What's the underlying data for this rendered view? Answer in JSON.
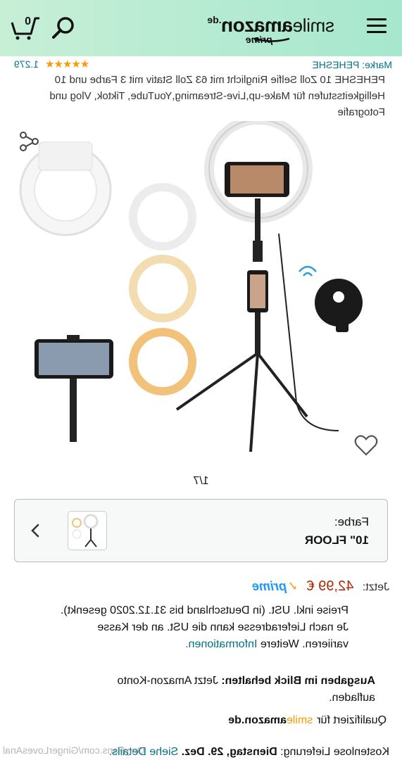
{
  "header": {
    "cart_count": "0",
    "logo": {
      "smile": "smile",
      "amazon": "amazon",
      "tld": ".de",
      "prime": "prime"
    },
    "bg_color": "#a6e7ce"
  },
  "product": {
    "brand": "Marke: PEHESHE",
    "rating_stars": "★★★★★",
    "rating_count": "1.279",
    "title": "PEHESHE 10 Zoll Selfie Ringlicht mit 63 Zoll Stativ mit 3 Farbe und 10 Helligkeitsstufen für Make-up,Live-Streaming,YouTube, Tiktok, Vlog und Fotografie"
  },
  "gallery": {
    "counter": "1/7",
    "icons": {
      "share": "share-icon",
      "wishlist": "heart-icon"
    }
  },
  "variant": {
    "label": "Farbe:",
    "value": "10\" FLOOR"
  },
  "price": {
    "label": "Jetzt:",
    "value": "42,99 €",
    "prime": "prime"
  },
  "tax_note": {
    "text": "Preise inkl. USt. (in Deutschland bis 31.12.2020 gesenkt). Je nach Lieferadresse kann die USt. an der Kasse variieren. Weitere ",
    "link": "Informationen."
  },
  "budget": {
    "bold": "Ausgaben im Blick behalten:",
    "text": " Jetzt Amazon-Konto aufladen."
  },
  "qualifies": {
    "text": "Qualifiziert für",
    "smile": "smile",
    "amazon": "amazon",
    "tld": ".de"
  },
  "delivery": {
    "text": "Kostenlose Lieferung: ",
    "date": "Dienstag, 29. Dez.",
    "link": "Siehe Details."
  },
  "watermark": "OnlyFans.com/GingerLovesAnal",
  "colors": {
    "link": "#007185",
    "price": "#b12704",
    "star": "#ff9900",
    "prime": "#1a98ff"
  }
}
